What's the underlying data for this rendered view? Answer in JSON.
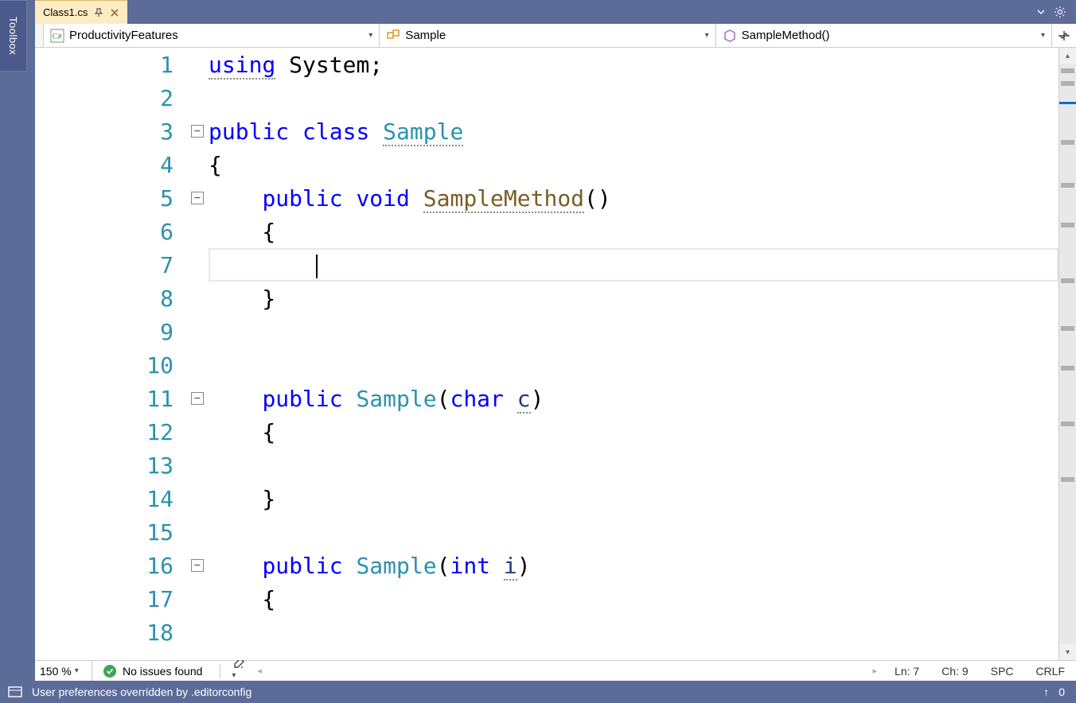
{
  "toolbox": {
    "label": "Toolbox"
  },
  "tabs": {
    "active": {
      "label": "Class1.cs",
      "pinned": true
    }
  },
  "nav": {
    "namespace": {
      "label": "ProductivityFeatures"
    },
    "class": {
      "label": "Sample"
    },
    "member": {
      "label": "SampleMethod()"
    }
  },
  "code": {
    "lines": [
      {
        "n": "1",
        "fold": "",
        "html": "<span class='tok-kw dotted-under'>using</span><span class='tok-plain'> System;</span>"
      },
      {
        "n": "2",
        "fold": "",
        "html": ""
      },
      {
        "n": "3",
        "fold": "box",
        "html": "<span class='tok-kw'>public</span><span class='tok-plain'> </span><span class='tok-kw'>class</span><span class='tok-plain'> </span><span class='tok-type dotted-under'>Sample</span>"
      },
      {
        "n": "4",
        "fold": "line",
        "html": "<span class='tok-plain'>{</span>"
      },
      {
        "n": "5",
        "fold": "box",
        "html": "<span class='tok-plain'>    </span><span class='tok-kw'>public</span><span class='tok-plain'> </span><span class='tok-kw'>void</span><span class='tok-plain'> </span><span class='tok-method dotted-under'>SampleMethod</span><span class='tok-plain'>()</span>"
      },
      {
        "n": "6",
        "fold": "line",
        "html": "<span class='tok-plain'>    {</span>"
      },
      {
        "n": "7",
        "fold": "line",
        "html": "<span class='tok-plain'>        </span><span class='caret'></span>",
        "current": true
      },
      {
        "n": "8",
        "fold": "line",
        "html": "<span class='tok-plain'>    }</span>"
      },
      {
        "n": "9",
        "fold": "line",
        "html": ""
      },
      {
        "n": "10",
        "fold": "line",
        "html": ""
      },
      {
        "n": "11",
        "fold": "box",
        "html": "<span class='tok-plain'>    </span><span class='tok-kw'>public</span><span class='tok-plain'> </span><span class='tok-type'>Sample</span><span class='tok-plain'>(</span><span class='tok-kw'>char</span><span class='tok-plain'> </span><span class='tok-param dotted-under'>c</span><span class='tok-plain'>)</span>"
      },
      {
        "n": "12",
        "fold": "line",
        "html": "<span class='tok-plain'>    {</span>"
      },
      {
        "n": "13",
        "fold": "line",
        "html": ""
      },
      {
        "n": "14",
        "fold": "line",
        "html": "<span class='tok-plain'>    }</span>"
      },
      {
        "n": "15",
        "fold": "line",
        "html": ""
      },
      {
        "n": "16",
        "fold": "box",
        "html": "<span class='tok-plain'>    </span><span class='tok-kw'>public</span><span class='tok-plain'> </span><span class='tok-type'>Sample</span><span class='tok-plain'>(</span><span class='tok-kw'>int</span><span class='tok-plain'> </span><span class='tok-param dotted-under'>i</span><span class='tok-plain'>)</span>"
      },
      {
        "n": "17",
        "fold": "line",
        "html": "<span class='tok-plain'>    {</span>"
      },
      {
        "n": "18",
        "fold": "line",
        "html": ""
      }
    ]
  },
  "editor_status": {
    "zoom": "150 %",
    "issues": "No issues found",
    "ln": "Ln: 7",
    "ch": "Ch: 9",
    "indent": "SPC",
    "eol": "CRLF"
  },
  "app_status": {
    "message": "User preferences overridden by .editorconfig",
    "notif_count": "0"
  }
}
